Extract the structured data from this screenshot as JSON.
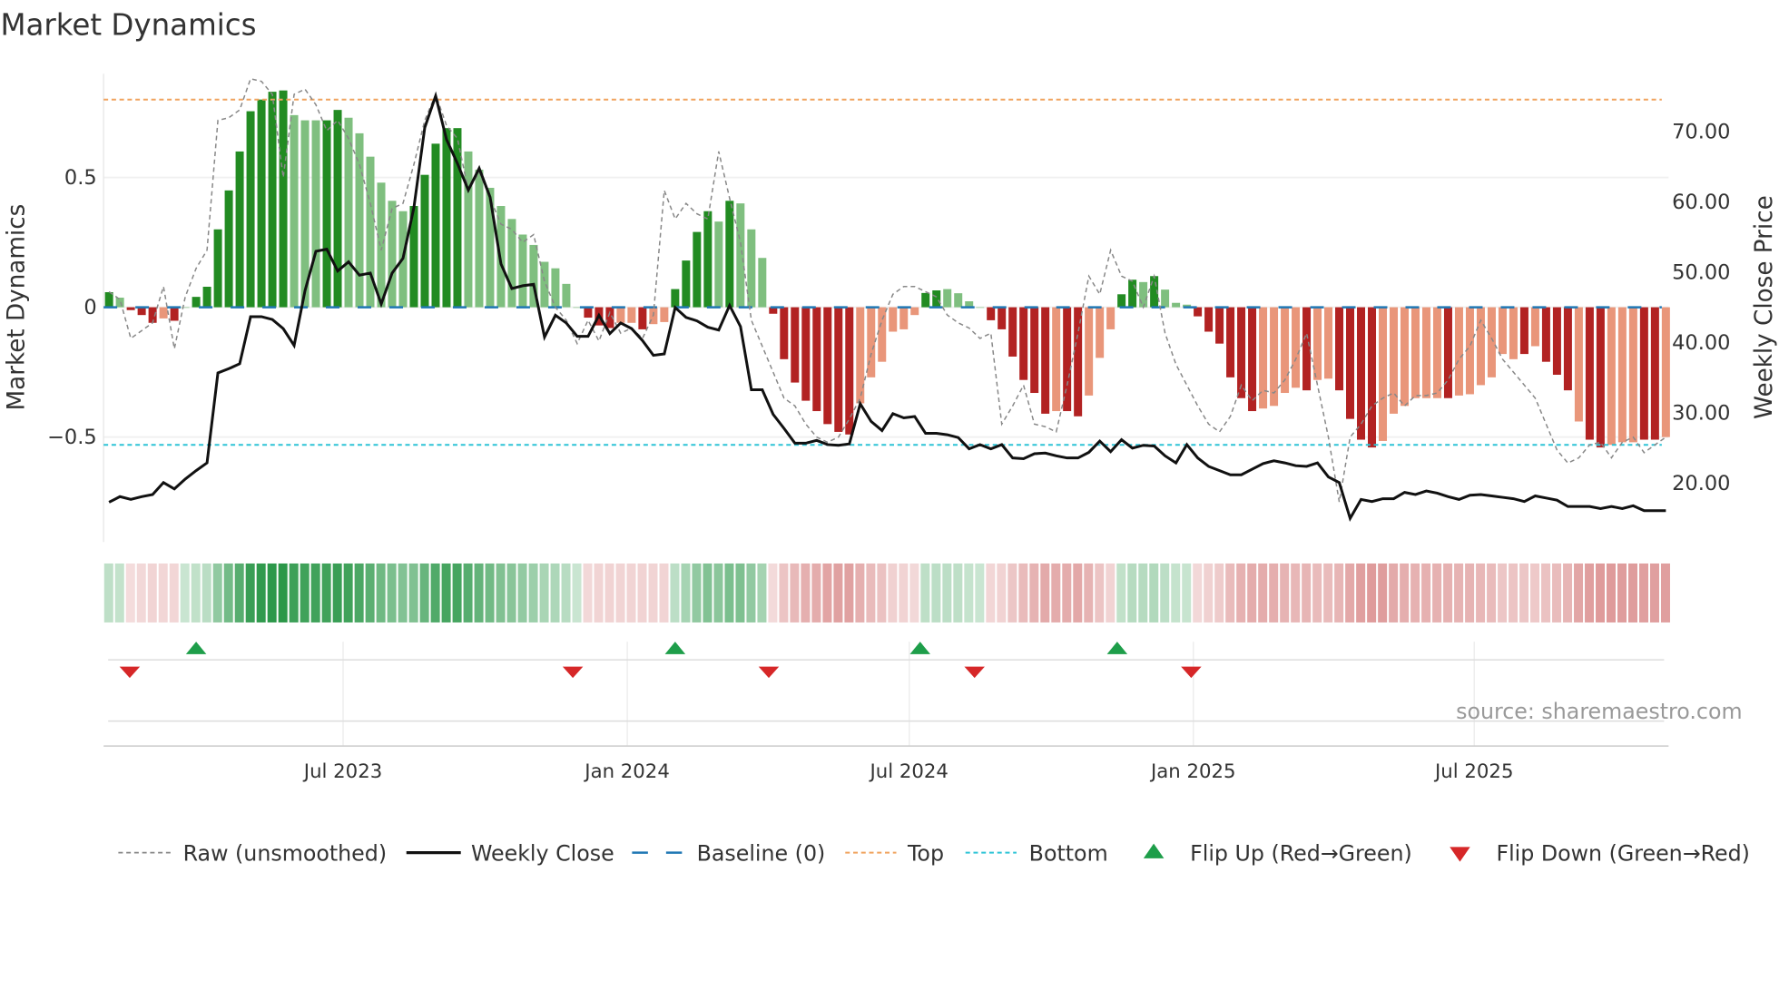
{
  "chart_data": {
    "type": "bar",
    "title": "Market Dynamics",
    "ylabel": "Market Dynamics",
    "y2label": "Weekly Close Price",
    "ylim": [
      -0.86,
      0.91
    ],
    "y2lim": [
      15.8,
      74.2
    ],
    "y_ticks": [
      {
        "v": 0.5,
        "label": "0.5"
      },
      {
        "v": 0,
        "label": "0"
      },
      {
        "v": -0.5,
        "label": "−0.5"
      }
    ],
    "y2_ticks": [
      {
        "v": 70,
        "label": "70.00"
      },
      {
        "v": 60,
        "label": "60.00"
      },
      {
        "v": 50,
        "label": "50.00"
      },
      {
        "v": 40,
        "label": "40.00"
      },
      {
        "v": 30,
        "label": "30.00"
      },
      {
        "v": 20,
        "label": "20.00"
      }
    ],
    "x_unit": "week index",
    "x_ticks": [
      {
        "week": 21.5,
        "label": "Jul 2023"
      },
      {
        "week": 47.6,
        "label": "Jan 2024"
      },
      {
        "week": 73.5,
        "label": "Jul 2024"
      },
      {
        "week": 99.6,
        "label": "Jan 2025"
      },
      {
        "week": 125.4,
        "label": "Jul 2025"
      }
    ],
    "top_level": 0.8,
    "bottom_level": -0.53,
    "baseline": 0,
    "values": [
      0.058,
      0.037,
      -0.011,
      -0.03,
      -0.06,
      -0.043,
      -0.052,
      0.0,
      0.04,
      0.079,
      0.3,
      0.45,
      0.6,
      0.755,
      0.8,
      0.83,
      0.835,
      0.74,
      0.72,
      0.72,
      0.72,
      0.76,
      0.73,
      0.67,
      0.58,
      0.48,
      0.41,
      0.37,
      0.39,
      0.51,
      0.63,
      0.69,
      0.69,
      0.6,
      0.53,
      0.46,
      0.39,
      0.34,
      0.28,
      0.24,
      0.175,
      0.15,
      0.09,
      0.0,
      -0.04,
      -0.07,
      -0.08,
      -0.06,
      -0.06,
      -0.085,
      -0.065,
      -0.057,
      0.07,
      0.18,
      0.29,
      0.37,
      0.33,
      0.41,
      0.4,
      0.3,
      0.19,
      -0.025,
      -0.2,
      -0.29,
      -0.36,
      -0.4,
      -0.45,
      -0.48,
      -0.49,
      -0.37,
      -0.27,
      -0.21,
      -0.094,
      -0.085,
      -0.03,
      0.055,
      0.065,
      0.07,
      0.054,
      0.023,
      0.0,
      -0.05,
      -0.085,
      -0.19,
      -0.28,
      -0.33,
      -0.41,
      -0.4,
      -0.4,
      -0.42,
      -0.34,
      -0.195,
      -0.085,
      0.05,
      0.106,
      0.097,
      0.12,
      0.068,
      0.017,
      0.01,
      -0.035,
      -0.094,
      -0.14,
      -0.27,
      -0.35,
      -0.4,
      -0.39,
      -0.38,
      -0.33,
      -0.31,
      -0.32,
      -0.28,
      -0.275,
      -0.32,
      -0.43,
      -0.51,
      -0.54,
      -0.515,
      -0.41,
      -0.38,
      -0.35,
      -0.35,
      -0.35,
      -0.35,
      -0.34,
      -0.335,
      -0.3,
      -0.27,
      -0.18,
      -0.2,
      -0.18,
      -0.15,
      -0.21,
      -0.26,
      -0.32,
      -0.44,
      -0.51,
      -0.54,
      -0.53,
      -0.52,
      -0.52,
      -0.51,
      -0.51,
      -0.5
    ],
    "strong": [
      1,
      0,
      1,
      1,
      1,
      0,
      1,
      0,
      1,
      1,
      1,
      1,
      1,
      1,
      1,
      1,
      1,
      0,
      0,
      0,
      1,
      1,
      0,
      0,
      0,
      0,
      0,
      0,
      1,
      1,
      1,
      1,
      1,
      0,
      0,
      0,
      0,
      0,
      0,
      0,
      0,
      0,
      0,
      0,
      1,
      1,
      1,
      0,
      0,
      1,
      0,
      0,
      1,
      1,
      1,
      1,
      0,
      1,
      0,
      0,
      0,
      1,
      1,
      1,
      1,
      1,
      1,
      1,
      1,
      0,
      0,
      0,
      0,
      0,
      0,
      1,
      1,
      0,
      0,
      0,
      0,
      1,
      1,
      1,
      1,
      1,
      1,
      0,
      1,
      1,
      0,
      0,
      0,
      1,
      1,
      0,
      1,
      0,
      0,
      0,
      1,
      1,
      1,
      1,
      1,
      1,
      0,
      0,
      0,
      0,
      1,
      0,
      0,
      1,
      1,
      1,
      1,
      0,
      0,
      0,
      0,
      0,
      0,
      1,
      0,
      0,
      0,
      0,
      0,
      0,
      1,
      0,
      1,
      1,
      1,
      0,
      1,
      1,
      0,
      0,
      0,
      1,
      1,
      0
    ],
    "raw": [
      0.06,
      0.03,
      -0.12,
      -0.09,
      -0.06,
      0.08,
      -0.16,
      0.04,
      0.15,
      0.22,
      0.72,
      0.73,
      0.76,
      0.88,
      0.87,
      0.82,
      0.5,
      0.82,
      0.84,
      0.78,
      0.68,
      0.72,
      0.65,
      0.55,
      0.4,
      0.22,
      0.38,
      0.4,
      0.55,
      0.72,
      0.82,
      0.7,
      0.65,
      0.45,
      0.52,
      0.42,
      0.32,
      0.3,
      0.25,
      0.28,
      0.1,
      0.0,
      -0.05,
      -0.14,
      -0.05,
      -0.13,
      -0.02,
      -0.1,
      -0.08,
      -0.12,
      -0.03,
      0.45,
      0.34,
      0.4,
      0.36,
      0.34,
      0.6,
      0.42,
      0.25,
      -0.05,
      -0.15,
      -0.25,
      -0.35,
      -0.38,
      -0.45,
      -0.5,
      -0.52,
      -0.5,
      -0.43,
      -0.35,
      -0.18,
      -0.05,
      0.05,
      0.08,
      0.08,
      0.06,
      0.04,
      -0.03,
      -0.06,
      -0.08,
      -0.12,
      -0.1,
      -0.45,
      -0.38,
      -0.3,
      -0.45,
      -0.46,
      -0.48,
      -0.3,
      -0.1,
      0.12,
      0.05,
      0.22,
      0.12,
      0.1,
      0.0,
      0.12,
      -0.1,
      -0.22,
      -0.3,
      -0.38,
      -0.45,
      -0.48,
      -0.42,
      -0.3,
      -0.36,
      -0.32,
      -0.33,
      -0.28,
      -0.2,
      -0.1,
      -0.3,
      -0.5,
      -0.75,
      -0.5,
      -0.45,
      -0.38,
      -0.35,
      -0.33,
      -0.38,
      -0.34,
      -0.34,
      -0.33,
      -0.28,
      -0.2,
      -0.15,
      -0.05,
      -0.12,
      -0.2,
      -0.25,
      -0.3,
      -0.35,
      -0.45,
      -0.55,
      -0.6,
      -0.58,
      -0.53,
      -0.52,
      -0.58,
      -0.52,
      -0.5,
      -0.56,
      -0.53,
      -0.5
    ],
    "close": [
      17.1,
      17.9,
      17.5,
      17.9,
      18.2,
      19.9,
      19.0,
      20.4,
      21.6,
      22.7,
      35.5,
      36.1,
      36.8,
      43.5,
      43.5,
      43.1,
      41.8,
      39.4,
      47.2,
      52.8,
      53.1,
      50.0,
      51.3,
      49.4,
      49.7,
      45.3,
      49.7,
      51.8,
      59.0,
      70.4,
      74.9,
      68.7,
      65.3,
      61.5,
      64.6,
      60.5,
      51.0,
      47.5,
      47.9,
      48.1,
      40.6,
      43.7,
      42.6,
      40.7,
      40.7,
      43.7,
      41.1,
      42.6,
      41.8,
      40.1,
      38.0,
      38.2,
      44.8,
      43.4,
      42.9,
      42.0,
      41.6,
      45.1,
      42.1,
      33.1,
      33.1,
      29.6,
      27.6,
      25.5,
      25.5,
      25.9,
      25.3,
      25.2,
      25.4,
      31.1,
      28.6,
      27.3,
      29.7,
      29.1,
      29.3,
      26.9,
      26.9,
      26.7,
      26.3,
      24.7,
      25.3,
      24.7,
      25.3,
      23.4,
      23.3,
      24.0,
      24.1,
      23.7,
      23.4,
      23.4,
      24.2,
      25.8,
      24.3,
      26.0,
      24.8,
      25.2,
      25.1,
      23.7,
      22.7,
      25.3,
      23.4,
      22.2,
      21.6,
      21.0,
      21.0,
      21.8,
      22.6,
      23.0,
      22.7,
      22.3,
      22.2,
      22.7,
      20.7,
      19.9,
      14.8,
      17.5,
      17.2,
      17.6,
      17.6,
      18.5,
      18.2,
      18.7,
      18.4,
      17.9,
      17.5,
      18.1,
      18.2,
      18.0,
      17.8,
      17.6,
      17.2,
      18.0,
      17.7,
      17.4,
      16.5,
      16.5,
      16.5,
      16.2,
      16.5,
      16.2,
      16.6,
      15.9,
      15.9,
      15.9
    ],
    "flip_up_weeks": [
      8,
      52,
      74.5,
      92.6
    ],
    "flip_down_weeks": [
      1.9,
      42.6,
      60.6,
      79.5,
      99.4
    ],
    "legend": {
      "raw": "Raw (unsmoothed)",
      "close": "Weekly Close",
      "baseline": "Baseline (0)",
      "top": "Top",
      "bottom": "Bottom",
      "flip_up": "Flip Up (Red→Green)",
      "flip_down": "Flip Down (Green→Red)"
    },
    "legend_placement": "bottom",
    "colors": {
      "pos_strong": "#228b22",
      "pos_weak": "#7fbf7f",
      "neg_strong": "#b22222",
      "neg_weak": "#e9967a",
      "top": "#f0a35e",
      "bottom": "#2ec4d6",
      "baseline": "#1f77b4",
      "flip_up": "#1e9e4a",
      "flip_down": "#d62728",
      "close": "#111111",
      "raw": "#888888"
    }
  },
  "source": "source: sharemaestro.com"
}
